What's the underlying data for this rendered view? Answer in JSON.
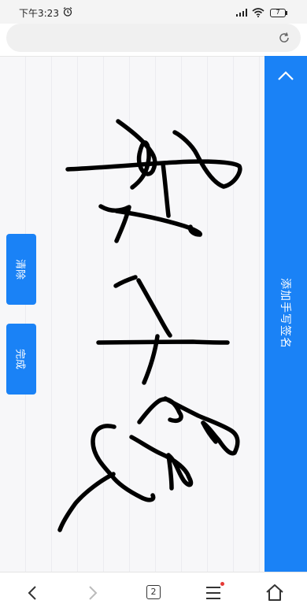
{
  "status_bar": {
    "time": "下午3:23",
    "battery": "7",
    "icons": [
      "alarm-icon",
      "signal-icon",
      "wifi-icon",
      "battery-icon"
    ]
  },
  "address_bar": {
    "placeholder": "",
    "icon": "refresh-icon"
  },
  "side_panel": {
    "title": "添加手写签名",
    "icon": "chevron-up-icon"
  },
  "actions": {
    "clear_label": "清除",
    "done_label": "完成"
  },
  "bottom_nav": {
    "tab_count": "2",
    "icons": [
      "back-icon",
      "forward-icon",
      "tabs-icon",
      "menu-icon",
      "home-icon"
    ]
  },
  "colors": {
    "accent": "#1a82f6",
    "canvas_bg": "#f7f7f9",
    "ink": "#000000",
    "notification_dot": "#e53935"
  }
}
